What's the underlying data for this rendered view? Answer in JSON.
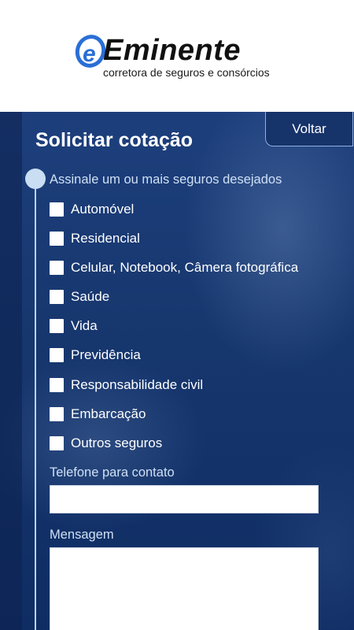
{
  "brand": {
    "name": "Eminente",
    "tagline": "corretora de seguros e consórcios",
    "logo_letter": "e",
    "colors": {
      "mark": "#2a6fd6",
      "text": "#111111"
    }
  },
  "form": {
    "title": "Solicitar cotação",
    "back_label": "Voltar",
    "instruction": "Assinale um ou mais seguros desejados",
    "options": [
      "Automóvel",
      "Residencial",
      "Celular, Notebook, Câmera fotográfica",
      "Saúde",
      "Vida",
      "Previdência",
      "Responsabilidade civil",
      "Embarcação",
      "Outros seguros"
    ],
    "phone_label": "Telefone para contato",
    "phone_value": "",
    "message_label": "Mensagem",
    "message_value": "",
    "colors": {
      "panel": "#17376f",
      "label": "#cfe0f5",
      "button": "#16336a"
    }
  }
}
